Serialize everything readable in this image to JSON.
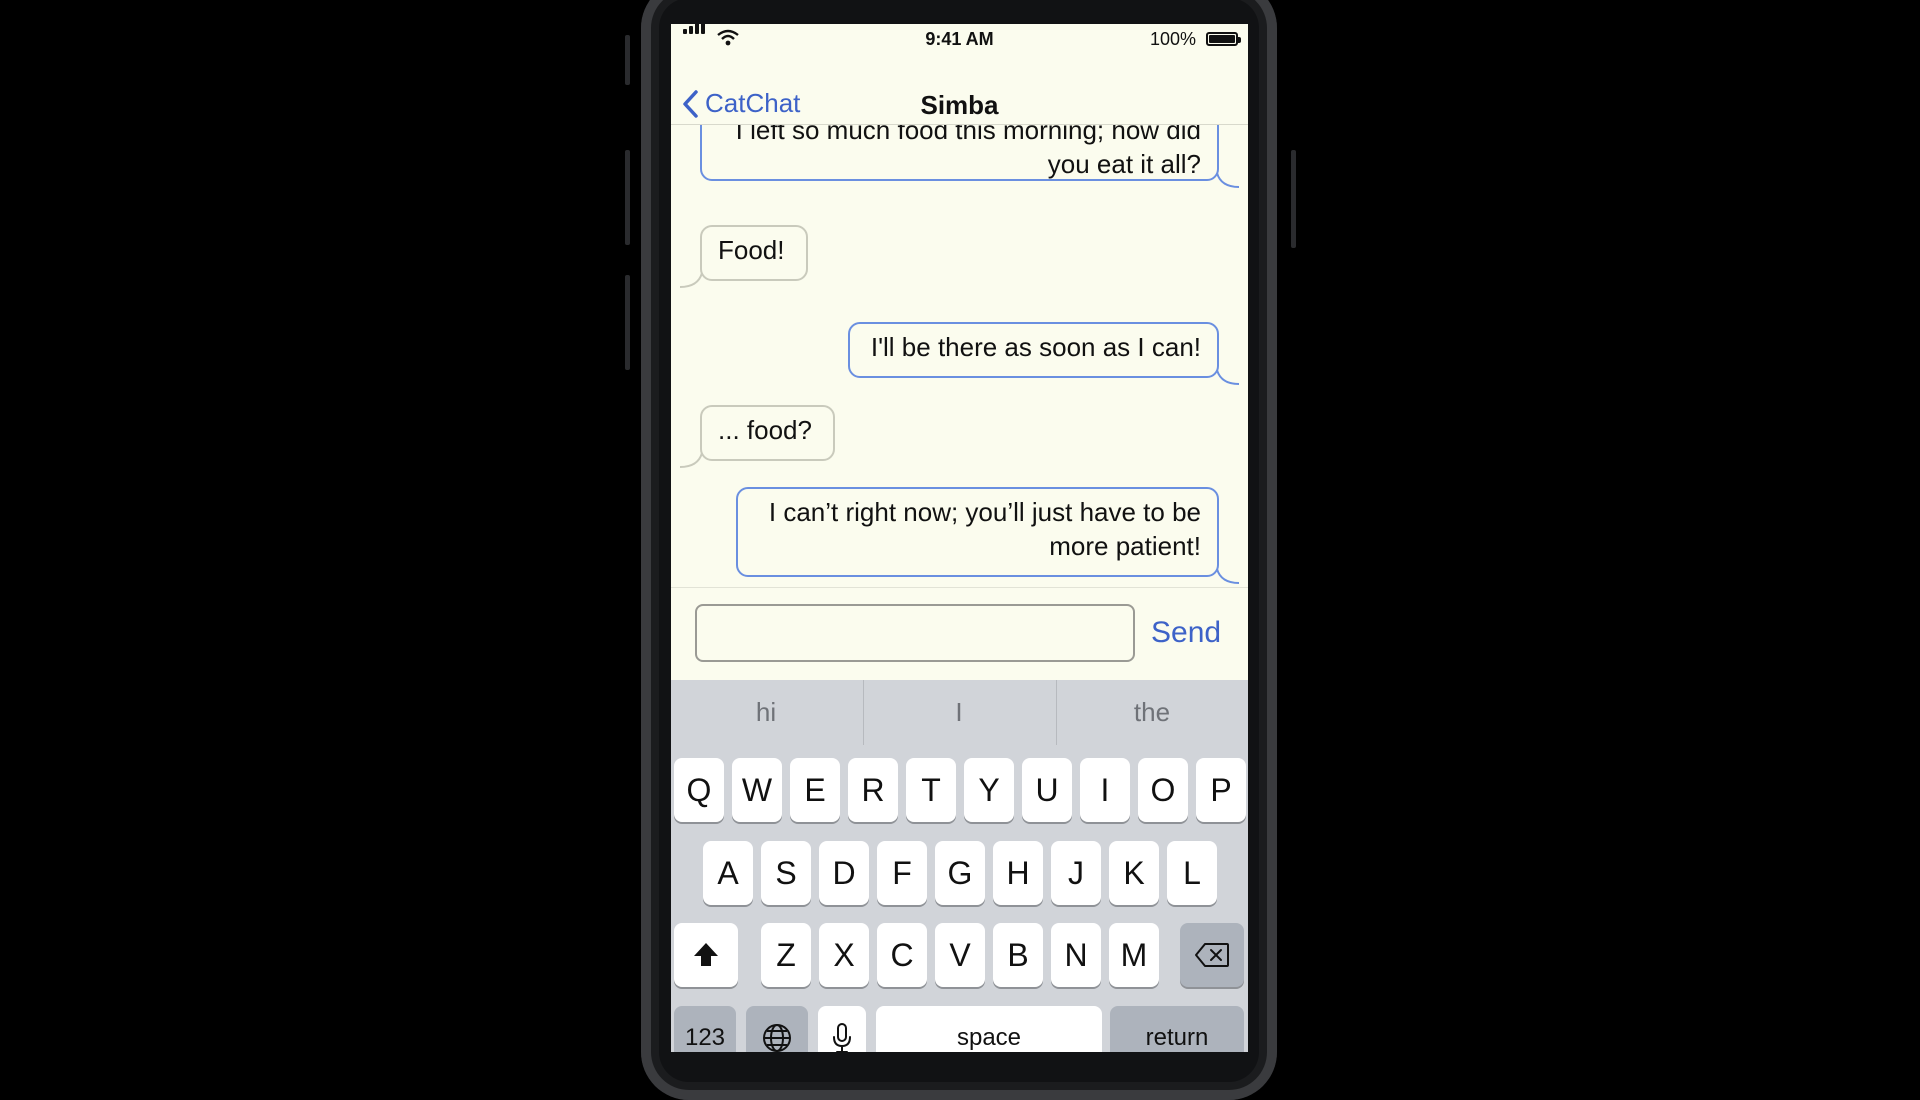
{
  "status_bar": {
    "time": "9:41 AM",
    "battery_percent": "100%",
    "icons": [
      "signal-icon",
      "wifi-icon",
      "battery-icon"
    ]
  },
  "nav": {
    "back_label": "CatChat",
    "title": "Simba",
    "back_icon": "chevron-left-icon"
  },
  "messages": [
    {
      "direction": "outgoing",
      "lines": [
        "I left so much food this morning; how did",
        "you eat it all?"
      ]
    },
    {
      "direction": "incoming",
      "lines": [
        "Food!"
      ]
    },
    {
      "direction": "outgoing",
      "lines": [
        "I'll be there as soon as I can!"
      ]
    },
    {
      "direction": "incoming",
      "lines": [
        "... food?"
      ]
    },
    {
      "direction": "outgoing",
      "lines": [
        "I can’t right now; you’ll just have to be",
        "more patient!"
      ]
    }
  ],
  "composer": {
    "input_value": "",
    "input_placeholder": "",
    "send_label": "Send"
  },
  "keyboard": {
    "suggestions": [
      "hi",
      "I",
      "the"
    ],
    "row1": [
      "Q",
      "W",
      "E",
      "R",
      "T",
      "Y",
      "U",
      "I",
      "O",
      "P"
    ],
    "row2": [
      "A",
      "S",
      "D",
      "F",
      "G",
      "H",
      "J",
      "K",
      "L"
    ],
    "row3": [
      "Z",
      "X",
      "C",
      "V",
      "B",
      "N",
      "M"
    ],
    "numbers_label": "123",
    "space_label": "space",
    "return_label": "return",
    "icons": [
      "shift-icon",
      "backspace-icon",
      "globe-icon",
      "microphone-icon"
    ]
  },
  "colors": {
    "accent": "#3d62c8",
    "screen_background": "#fbfcee",
    "outgoing_border": "#6a8fe0",
    "incoming_border": "#c9cabc",
    "keyboard_background": "#d1d4d9"
  }
}
